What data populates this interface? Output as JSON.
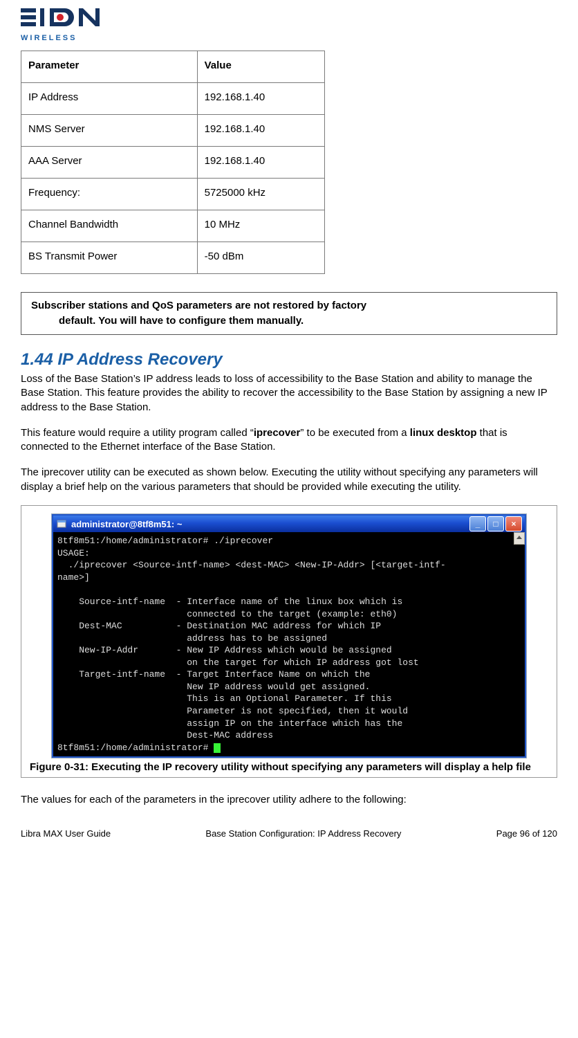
{
  "logo": {
    "brand_top": "EION",
    "brand_bottom": "WIRELESS"
  },
  "table": {
    "headers": {
      "param": "Parameter",
      "value": "Value"
    },
    "rows": [
      {
        "param": "IP Address",
        "value": "192.168.1.40"
      },
      {
        "param": "NMS Server",
        "value": "192.168.1.40"
      },
      {
        "param": "AAA Server",
        "value": "192.168.1.40"
      },
      {
        "param": "Frequency:",
        "value": "5725000 kHz"
      },
      {
        "param": "Channel Bandwidth",
        "value": "10 MHz"
      },
      {
        "param": "BS Transmit Power",
        "value": "-50 dBm"
      }
    ]
  },
  "note": {
    "line1": "Subscriber stations and QoS parameters are not restored by factory",
    "line2": "default. You will have to configure them manually."
  },
  "section": {
    "heading": "1.44 IP Address Recovery",
    "p1": "Loss of the Base Station’s IP address leads to loss of accessibility to the Base Station and ability to manage the Base Station. This feature provides the ability to recover the accessibility to the Base Station by assigning a new IP address to the Base Station.",
    "p2_a": "This feature would require a utility program called “",
    "p2_b1": "iprecover",
    "p2_c": "” to be executed from a ",
    "p2_b2": "linux desktop",
    "p2_d": " that is connected to the Ethernet interface of the Base Station.",
    "p3": "The iprecover utility can be executed as shown below. Executing the utility without specifying any parameters will display a brief help on the various parameters that should be provided while executing the utility."
  },
  "terminal": {
    "title": "administrator@8tf8m51: ~",
    "lines": "8tf8m51:/home/administrator# ./iprecover\nUSAGE:\n  ./iprecover <Source-intf-name> <dest-MAC> <New-IP-Addr> [<target-intf-\nname>]\n\n    Source-intf-name  - Interface name of the linux box which is\n                        connected to the target (example: eth0)\n    Dest-MAC          - Destination MAC address for which IP\n                        address has to be assigned\n    New-IP-Addr       - New IP Address which would be assigned\n                        on the target for which IP address got lost\n    Target-intf-name  - Target Interface Name on which the\n                        New IP address would get assigned.\n                        This is an Optional Parameter. If this\n                        Parameter is not specified, then it would\n                        assign IP on the interface which has the\n                        Dest-MAC address\n8tf8m51:/home/administrator# "
  },
  "figure_caption": "Figure 0-31: Executing the IP recovery utility without specifying any parameters will display a help file",
  "closing_para": "The values for each of the parameters in the iprecover utility adhere to the following:",
  "footer": {
    "left": "Libra MAX User Guide",
    "center": "Base Station Configuration: IP Address Recovery",
    "right": "Page 96 of 120"
  }
}
